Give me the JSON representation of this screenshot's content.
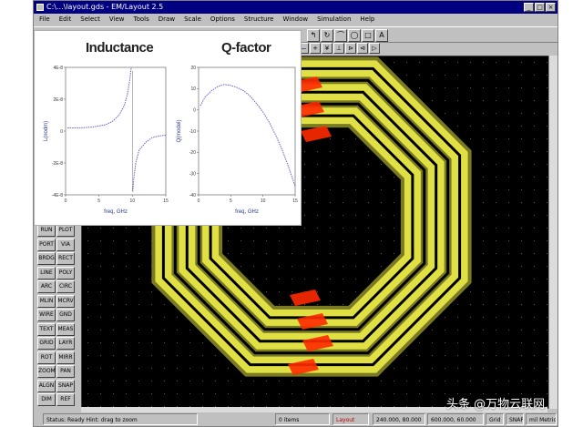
{
  "window": {
    "title": "C:\\...\\layout.gds - EM/Layout 2.5",
    "controls": [
      "_",
      "□",
      "×"
    ]
  },
  "menu": [
    "File",
    "Edit",
    "Select",
    "View",
    "Tools",
    "Draw",
    "Scale",
    "Options",
    "Structure",
    "Window",
    "Simulation",
    "Help"
  ],
  "toolbar": [
    "↰",
    "↻",
    "⌒",
    "◯",
    "□",
    "A"
  ],
  "toolbar2": [
    "—",
    "+",
    "¥",
    "⊥",
    "⊳",
    "⊲",
    "▷"
  ],
  "palette": [
    "RUN",
    "PLOT",
    "PORT",
    "VIA",
    "BRDG",
    "RECT",
    "LINE",
    "POLY",
    "ARC",
    "CIRC",
    "MLIN",
    "MCRV",
    "WIRE",
    "GND",
    "TEXT",
    "MEAS",
    "GRID",
    "LAYR",
    "ROT",
    "MIRR",
    "ZOOM",
    "PAN",
    "ALGN",
    "SNAP",
    "DIM",
    "REF"
  ],
  "charts": {
    "inductance": {
      "title": "Inductance"
    },
    "qfactor": {
      "title": "Q-factor"
    }
  },
  "chart_data": [
    {
      "type": "line",
      "title": "Inductance",
      "xlabel": "freq, GHz",
      "ylabel": "L(nodm)",
      "xlim": [
        0,
        15
      ],
      "ylim": [
        -4e-08,
        4e-08
      ],
      "xticks": [
        "0",
        "5",
        "10",
        "15"
      ],
      "yticks": [
        "4E-8",
        "2E-8",
        "0",
        "-2E-8",
        "-4E-8"
      ],
      "series": [
        {
          "x": [
            0.3,
            2,
            4,
            6,
            7,
            8,
            8.8,
            9.3,
            9.6,
            9.8,
            9.95,
            10.05,
            10.2,
            10.5,
            11,
            12,
            13,
            14,
            15
          ],
          "y": [
            2e-09,
            2e-09,
            2.5e-09,
            4e-09,
            6e-09,
            1e-08,
            1.6e-08,
            2.4e-08,
            3.2e-08,
            3.9e-08,
            4e-08,
            -3.8e-08,
            -3e-08,
            -2e-08,
            -1.2e-08,
            -7e-09,
            -4e-09,
            -3e-09,
            -2.5e-09
          ]
        }
      ]
    },
    {
      "type": "line",
      "title": "Q-factor",
      "xlabel": "freq, GHz",
      "ylabel": "Q(model)",
      "xlim": [
        0,
        15
      ],
      "ylim": [
        -40,
        20
      ],
      "xticks": [
        "0",
        "5",
        "10",
        "15"
      ],
      "yticks": [
        "20",
        "10",
        "0",
        "-10",
        "-20",
        "-30",
        "-40"
      ],
      "series": [
        {
          "x": [
            0.3,
            1,
            2,
            3,
            4,
            5,
            6,
            7,
            8,
            9,
            10,
            11,
            12,
            13,
            14,
            15
          ],
          "y": [
            2,
            6,
            9,
            11,
            12,
            11.5,
            10.5,
            9,
            6.5,
            3,
            -1,
            -6,
            -12,
            -19,
            -27,
            -36
          ]
        }
      ]
    }
  ],
  "status": {
    "left": "Status: Ready  Hint: drag to zoom",
    "mid": "0 items",
    "red": "Layout",
    "coord1": "240.000, 80.000",
    "coord2": "600.000, 60.000",
    "grid": "Grid",
    "snap": "SNAP",
    "units": "mil  Metric"
  },
  "colors": {
    "canvas": "#000000",
    "metal": "#f2f24a",
    "metal_dim": "#7a7a22",
    "via": "#ff2a00",
    "curve": "#6a5fc8",
    "titlebar": "#000080"
  },
  "watermark": "头条 @万物云联网"
}
